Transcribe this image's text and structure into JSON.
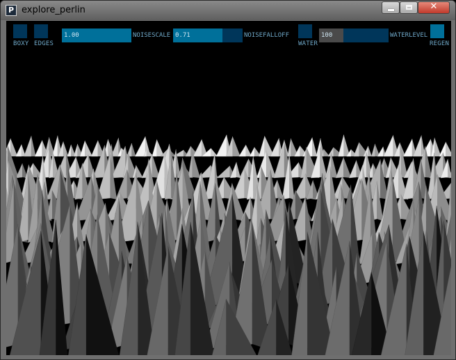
{
  "window": {
    "title": "explore_perlin",
    "app_icon_letter": "P"
  },
  "colors": {
    "toggle_off": "#00365a",
    "toggle_on": "#00709a",
    "label": "#6fa8c8",
    "background": "#000000"
  },
  "controls": {
    "boxy": {
      "label": "BOXY",
      "state": "off"
    },
    "edges": {
      "label": "EDGES",
      "state": "off"
    },
    "noisescale": {
      "label": "NOISESCALE",
      "value": "1.00",
      "fill_fraction": 1.0
    },
    "noisefalloff": {
      "label": "NOISEFALLOFF",
      "value": "0.71",
      "fill_fraction": 0.5
    },
    "water": {
      "label": "WATER",
      "state": "off"
    },
    "waterlevel": {
      "label": "WATERLEVEL",
      "value": "100",
      "fill_fraction": 0.35
    },
    "regen": {
      "label": "REGEN"
    }
  },
  "scene": {
    "content": "3d-perlin-noise-terrain-mesh",
    "shading": "greyscale-flat"
  }
}
